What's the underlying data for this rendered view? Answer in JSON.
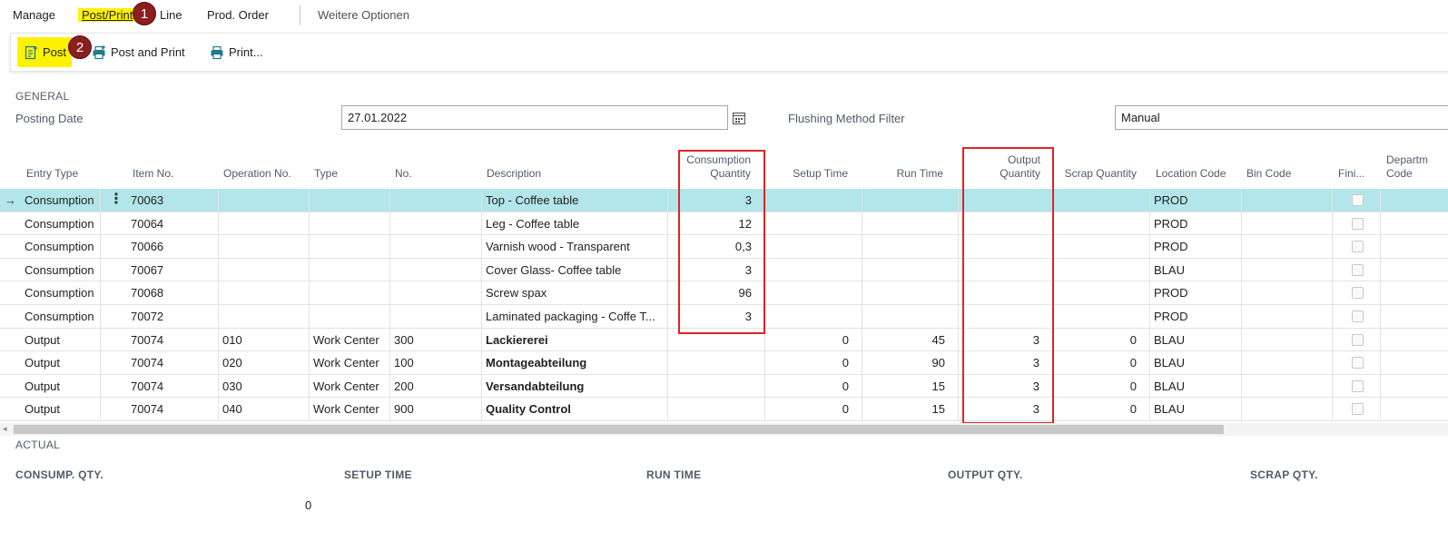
{
  "menu": {
    "manage": "Manage",
    "post_print": "Post/Print",
    "line": "Line",
    "prod_order": "Prod. Order",
    "more": "Weitere Optionen"
  },
  "actions": {
    "post": "Post",
    "post_and_print": "Post and Print",
    "print": "Print..."
  },
  "badges": {
    "one": "1",
    "two": "2"
  },
  "general": {
    "title": "GENERAL",
    "posting_date_label": "Posting Date",
    "posting_date_value": "27.01.2022",
    "flushing_label": "Flushing Method Filter",
    "flushing_value": "Manual"
  },
  "table": {
    "headers": {
      "entry_type": "Entry Type",
      "item_no": "Item No.",
      "operation_no": "Operation No.",
      "type": "Type",
      "no": "No.",
      "description": "Description",
      "consumption_qty_1": "Consumption",
      "consumption_qty_2": "Quantity",
      "setup_time": "Setup Time",
      "run_time": "Run Time",
      "output_qty_1": "Output",
      "output_qty_2": "Quantity",
      "scrap_qty": "Scrap Quantity",
      "location_code": "Location Code",
      "bin_code": "Bin Code",
      "finished": "Fini...",
      "department_1": "Departm",
      "department_2": "Code"
    },
    "rows": [
      {
        "entry_type": "Consumption",
        "item_no": "70063",
        "operation_no": "",
        "type": "",
        "no": "",
        "description": "Top - Coffee table",
        "consumption_qty": "3",
        "setup_time": "",
        "run_time": "",
        "output_qty": "",
        "scrap_qty": "",
        "location_code": "PROD",
        "bin_code": ""
      },
      {
        "entry_type": "Consumption",
        "item_no": "70064",
        "operation_no": "",
        "type": "",
        "no": "",
        "description": "Leg - Coffee table",
        "consumption_qty": "12",
        "setup_time": "",
        "run_time": "",
        "output_qty": "",
        "scrap_qty": "",
        "location_code": "PROD",
        "bin_code": ""
      },
      {
        "entry_type": "Consumption",
        "item_no": "70066",
        "operation_no": "",
        "type": "",
        "no": "",
        "description": "Varnish wood - Transparent",
        "consumption_qty": "0,3",
        "setup_time": "",
        "run_time": "",
        "output_qty": "",
        "scrap_qty": "",
        "location_code": "PROD",
        "bin_code": ""
      },
      {
        "entry_type": "Consumption",
        "item_no": "70067",
        "operation_no": "",
        "type": "",
        "no": "",
        "description": "Cover Glass- Coffee table",
        "consumption_qty": "3",
        "setup_time": "",
        "run_time": "",
        "output_qty": "",
        "scrap_qty": "",
        "location_code": "BLAU",
        "bin_code": ""
      },
      {
        "entry_type": "Consumption",
        "item_no": "70068",
        "operation_no": "",
        "type": "",
        "no": "",
        "description": "Screw spax",
        "consumption_qty": "96",
        "setup_time": "",
        "run_time": "",
        "output_qty": "",
        "scrap_qty": "",
        "location_code": "PROD",
        "bin_code": ""
      },
      {
        "entry_type": "Consumption",
        "item_no": "70072",
        "operation_no": "",
        "type": "",
        "no": "",
        "description": "Laminated packaging - Coffe T...",
        "consumption_qty": "3",
        "setup_time": "",
        "run_time": "",
        "output_qty": "",
        "scrap_qty": "",
        "location_code": "PROD",
        "bin_code": ""
      },
      {
        "entry_type": "Output",
        "item_no": "70074",
        "operation_no": "010",
        "type": "Work Center",
        "no": "300",
        "description": "Lackiererei",
        "consumption_qty": "",
        "setup_time": "0",
        "run_time": "45",
        "output_qty": "3",
        "scrap_qty": "0",
        "location_code": "BLAU",
        "bin_code": ""
      },
      {
        "entry_type": "Output",
        "item_no": "70074",
        "operation_no": "020",
        "type": "Work Center",
        "no": "100",
        "description": "Montageabteilung",
        "consumption_qty": "",
        "setup_time": "0",
        "run_time": "90",
        "output_qty": "3",
        "scrap_qty": "0",
        "location_code": "BLAU",
        "bin_code": ""
      },
      {
        "entry_type": "Output",
        "item_no": "70074",
        "operation_no": "030",
        "type": "Work Center",
        "no": "200",
        "description": "Versandabteilung",
        "consumption_qty": "",
        "setup_time": "0",
        "run_time": "15",
        "output_qty": "3",
        "scrap_qty": "0",
        "location_code": "BLAU",
        "bin_code": ""
      },
      {
        "entry_type": "Output",
        "item_no": "70074",
        "operation_no": "040",
        "type": "Work Center",
        "no": "900",
        "description": "Quality Control",
        "consumption_qty": "",
        "setup_time": "0",
        "run_time": "15",
        "output_qty": "3",
        "scrap_qty": "0",
        "location_code": "BLAU",
        "bin_code": ""
      }
    ]
  },
  "actual": {
    "title": "ACTUAL",
    "consump_qty_label": "CONSUMP. QTY.",
    "setup_time_label": "SETUP TIME",
    "run_time_label": "RUN TIME",
    "output_qty_label": "OUTPUT QTY.",
    "scrap_qty_label": "SCRAP QTY.",
    "consump_qty_value": "0"
  },
  "colors": {
    "highlight": "#fff200",
    "selected_row": "#b3e6ea",
    "red_box": "#e02424",
    "badge": "#8a1f1f",
    "icon_teal": "#1f7a8c"
  },
  "icons": {
    "post": "post-document-icon",
    "post_and_print": "post-print-icon",
    "print": "printer-icon",
    "calendar": "calendar-icon",
    "row_arrow": "arrow-right-icon",
    "row_menu": "more-vertical-icon",
    "scroll_left": "chevron-left-icon"
  }
}
